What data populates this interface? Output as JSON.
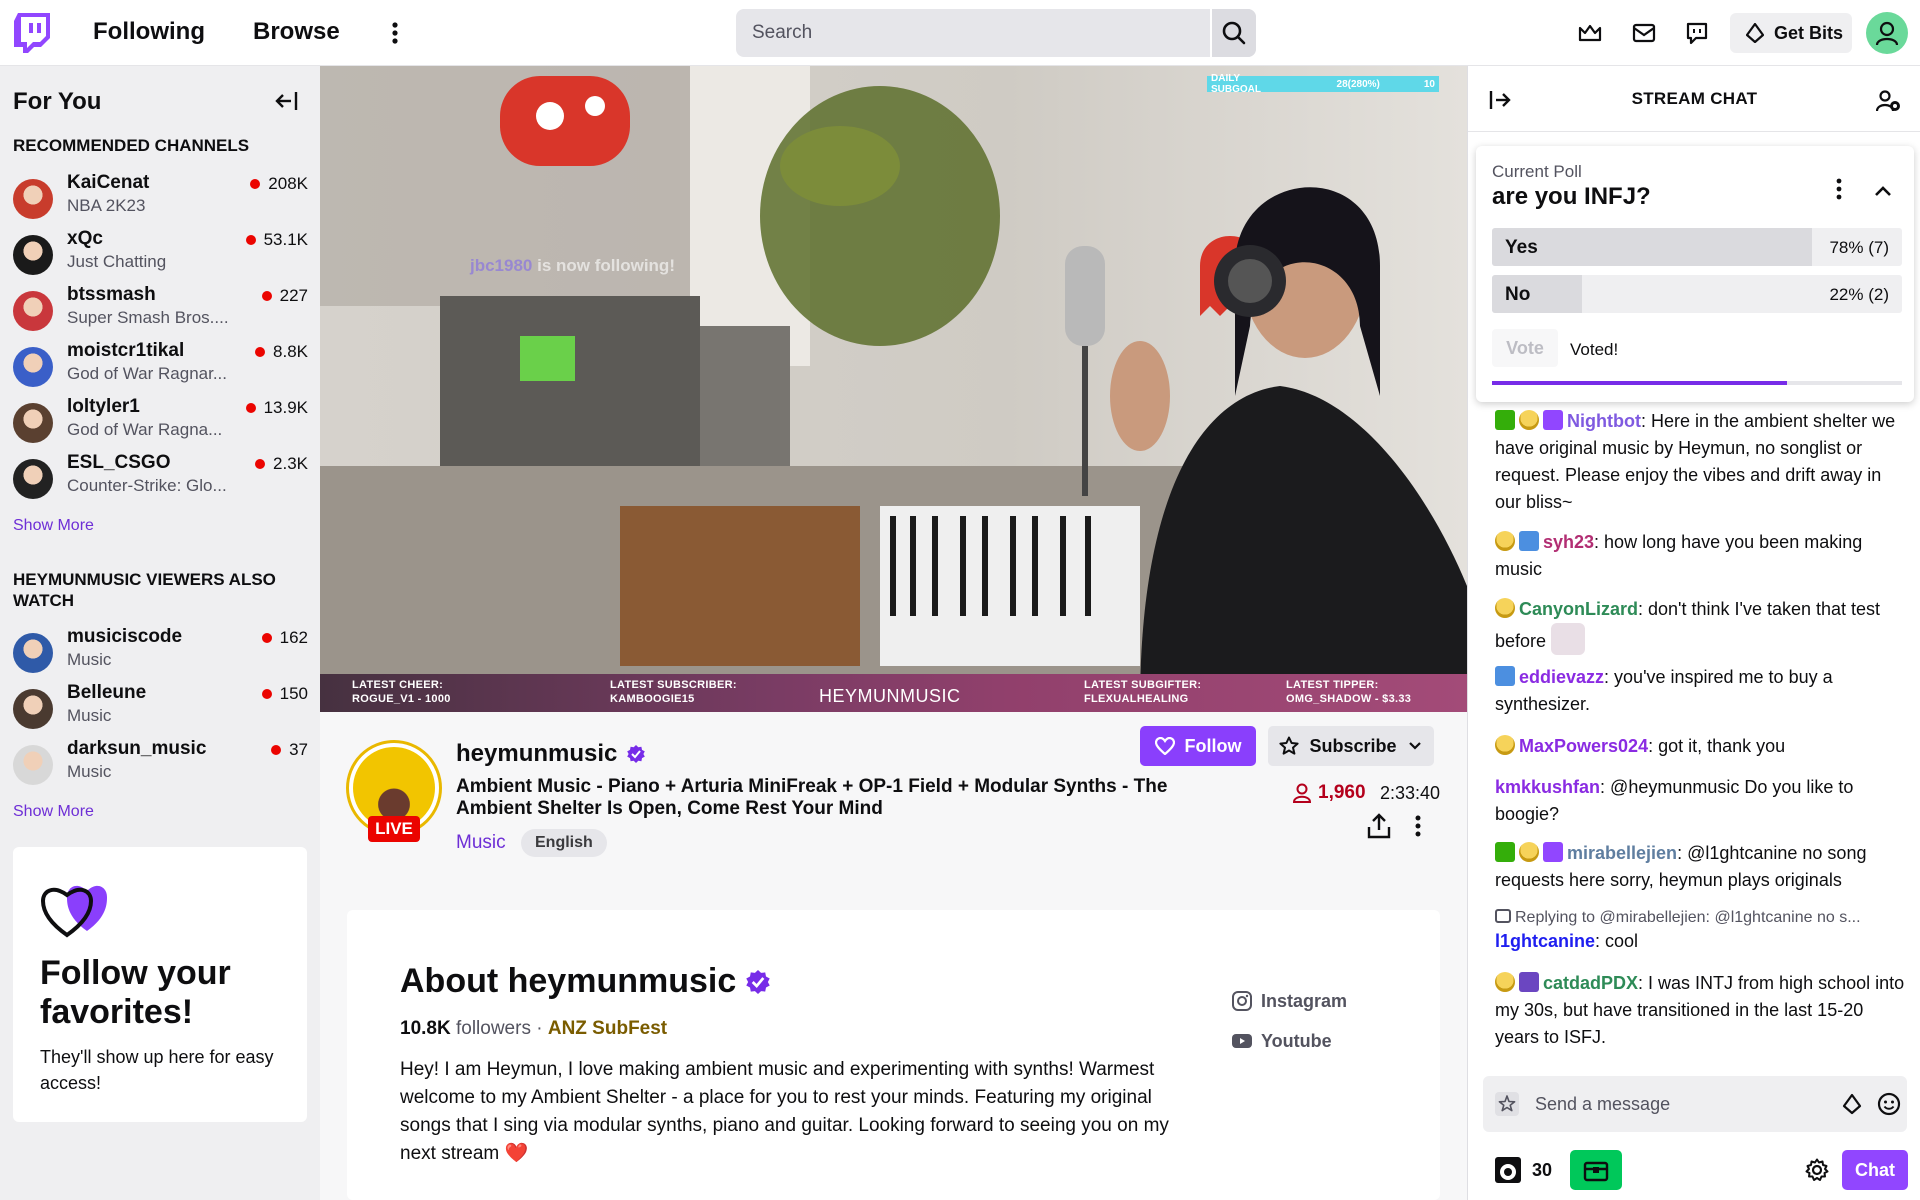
{
  "nav": {
    "following": "Following",
    "browse": "Browse",
    "search_placeholder": "Search",
    "get_bits": "Get Bits"
  },
  "sidebar": {
    "title": "For You",
    "recommended_title": "RECOMMENDED CHANNELS",
    "recommended": [
      {
        "name": "KaiCenat",
        "game": "NBA 2K23",
        "viewers": "208K",
        "avatar_color": "#c83c2c"
      },
      {
        "name": "xQc",
        "game": "Just Chatting",
        "viewers": "53.1K",
        "avatar_color": "#1a1a1a"
      },
      {
        "name": "btssmash",
        "game": "Super Smash Bros....",
        "viewers": "227",
        "avatar_color": "#c9373c"
      },
      {
        "name": "moistcr1tikal",
        "game": "God of War Ragnar...",
        "viewers": "8.8K",
        "avatar_color": "#3a5fc8"
      },
      {
        "name": "loltyler1",
        "game": "God of War Ragna...",
        "viewers": "13.9K",
        "avatar_color": "#5a4030"
      },
      {
        "name": "ESL_CSGO",
        "game": "Counter-Strike: Glo...",
        "viewers": "2.3K",
        "avatar_color": "#222222"
      }
    ],
    "show_more_1": "Show More",
    "also_watch_title": "HEYMUNMUSIC VIEWERS ALSO WATCH",
    "also_watch": [
      {
        "name": "musiciscode",
        "game": "Music",
        "viewers": "162",
        "avatar_color": "#2f5aa8"
      },
      {
        "name": "Belleune",
        "game": "Music",
        "viewers": "150",
        "avatar_color": "#4a3a30"
      },
      {
        "name": "darksun_music",
        "game": "Music",
        "viewers": "37",
        "avatar_color": "#d8d8d8"
      }
    ],
    "show_more_2": "Show More",
    "follow_card": {
      "title": "Follow your favorites!",
      "text": "They'll show up here for easy access!"
    }
  },
  "video": {
    "subgoal_label": "DAILY SUBGOAL",
    "subgoal_value": "28(280%)",
    "subgoal_target": "10",
    "follow_alert_user": "jbc1980",
    "follow_alert_text": " is now following!",
    "bar": {
      "latest_cheer": "LATEST CHEER: ROGUE_V1 - 1000",
      "latest_subscriber": "LATEST SUBSCRIBER: KAMBOOGIE15",
      "brand": "HEYMUNMUSIC",
      "latest_subgifter": "LATEST SUBGIFTER: FLEXUALHEALING",
      "latest_tipper": "LATEST TIPPER: OMG_SHADOW - $3.33"
    }
  },
  "channel": {
    "name": "heymunmusic",
    "live": "LIVE",
    "title": "Ambient Music - Piano + Arturia MiniFreak + OP-1 Field + Modular Synths - The Ambient Shelter Is Open, Come Rest Your Mind",
    "category": "Music",
    "language": "English",
    "follow": "Follow",
    "subscribe": "Subscribe",
    "viewers": "1,960",
    "uptime": "2:33:40"
  },
  "about": {
    "title": "About heymunmusic",
    "followers_count": "10.8K",
    "followers_label": "followers",
    "separator": " · ",
    "team": "ANZ SubFest",
    "description": "Hey! I am Heymun, I love making ambient music and experimenting with synths! Warmest welcome to my Ambient Shelter - a place for you to rest your minds. Featuring my original songs that I sing via modular synths, piano and guitar. Looking forward to seeing you on my next stream ❤️",
    "social": [
      "Instagram",
      "Youtube"
    ]
  },
  "chat": {
    "title": "STREAM CHAT",
    "poll": {
      "label": "Current Poll",
      "question": "are you INFJ?",
      "options": [
        {
          "label": "Yes",
          "value": "78% (7)",
          "pct": 78
        },
        {
          "label": "No",
          "value": "22% (2)",
          "pct": 22
        }
      ],
      "vote": "Vote",
      "voted": "Voted!",
      "time_remaining_pct": 72
    },
    "messages": [
      {
        "user": "Nightbot",
        "color": "#7f5ae0",
        "text": ": Here in the ambient shelter we have original music by Heymun, no songlist or request. Please enjoy the vibes and drift away in our bliss~"
      },
      {
        "user": "syh23",
        "color": "#b22e73",
        "text": ": how long have you been making music"
      },
      {
        "user": "CanyonLizard",
        "color": "#2e8b57",
        "text": ": don't think I've taken that test before"
      },
      {
        "user": "eddievazz",
        "color": "#8a2be2",
        "text": ": you've inspired me to buy a synthesizer."
      },
      {
        "user": "MaxPowers024",
        "color": "#8a2be2",
        "text": ": got it, thank you"
      },
      {
        "user": "kmkkushfan",
        "color": "#8a2be2",
        "text": ": @heymunmusic Do you like to boogie?"
      },
      {
        "user": "mirabellejien",
        "color": "#5f7ea0",
        "text": ": @l1ghtcanine no song requests here sorry, heymun plays originals"
      },
      {
        "reply": "Replying to @mirabellejien: @l1ghtcanine no s...",
        "user": "l1ghtcanine",
        "color": "#1e1ef0",
        "text": ": cool"
      },
      {
        "user": "catdadPDX",
        "color": "#2e8b57",
        "text": ": I was INTJ from high school into my 30s, but have transitioned in the last 15-20 years to ISFJ."
      }
    ],
    "input_placeholder": "Send a message",
    "points": "30",
    "chat_button": "Chat"
  },
  "colors": {
    "brand": "#9146ff",
    "live": "#eb0400",
    "follow_button": "#8a3ffc"
  }
}
